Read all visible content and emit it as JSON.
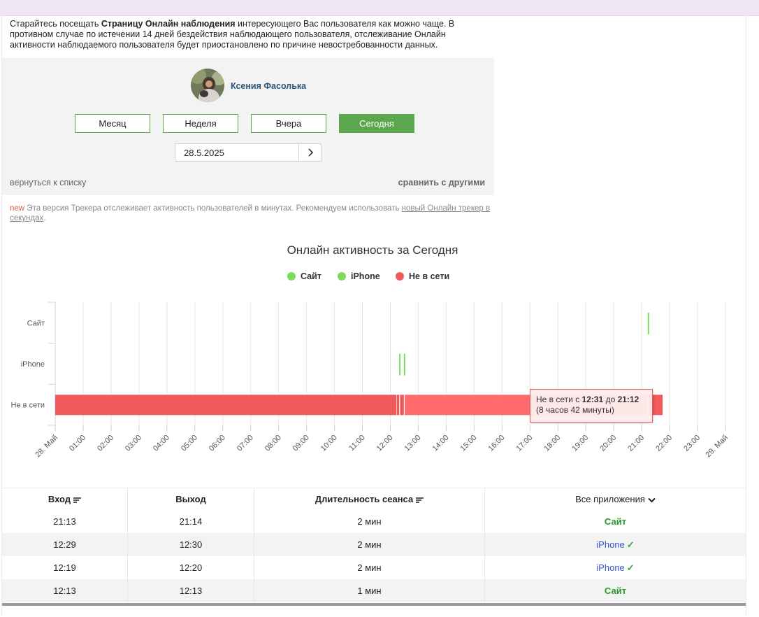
{
  "notice": {
    "pre": "Старайтесь посещать ",
    "bold": "Страницу Онлайн наблюдения",
    "post": " интересующего Вас пользователя как можно чаще. В противном случае по истечении 14 дней бездействия наблюдающего пользователя, отслеживание Онлайн активности наблюдаемого пользователя будет приостановлено по причине невостребованности данных."
  },
  "profile": {
    "name": "Ксения Фасолька"
  },
  "period_buttons": [
    {
      "label": "Месяц",
      "active": false
    },
    {
      "label": "Неделя",
      "active": false
    },
    {
      "label": "Вчера",
      "active": false
    },
    {
      "label": "Сегодня",
      "active": true
    }
  ],
  "date": {
    "value": "28.5.2025",
    "next_icon": "chevron-right-icon"
  },
  "links": {
    "back": "вернуться к списку",
    "compare": "сравнить с другими"
  },
  "new_note": {
    "badge": "new",
    "text": " Эта версия Трекера отслеживает активность пользователей в минутах. Рекомендуем использовать ",
    "link": "новый Онлайн трекер в секундах",
    "end": "."
  },
  "chart_data": {
    "type": "timeline",
    "title": "Онлайн активность за Сегодня",
    "legend": [
      {
        "name": "Сайт",
        "color": "#7ddc5a"
      },
      {
        "name": "iPhone",
        "color": "#7ddc5a"
      },
      {
        "name": "Не в сети",
        "color": "#f05a5a"
      }
    ],
    "categories": [
      "Сайт",
      "iPhone",
      "Не в сети"
    ],
    "x_ticks": [
      "28. Май",
      "01:00",
      "02:00",
      "03:00",
      "04:00",
      "05:00",
      "06:00",
      "07:00",
      "08:00",
      "09:00",
      "10:00",
      "11:00",
      "12:00",
      "13:00",
      "14:00",
      "15:00",
      "16:00",
      "17:00",
      "18:00",
      "19:00",
      "20:00",
      "21:00",
      "22:00",
      "23:00",
      "29. Май"
    ],
    "xlim": [
      "00:00",
      "24:00"
    ],
    "intervals": [
      {
        "category": "Сайт",
        "start": "21:13",
        "end": "21:14"
      },
      {
        "category": "iPhone",
        "start": "12:19",
        "end": "12:20"
      },
      {
        "category": "iPhone",
        "start": "12:29",
        "end": "12:30"
      },
      {
        "category": "Не в сети",
        "start": "00:00",
        "end": "12:13"
      },
      {
        "category": "Не в сети",
        "start": "12:14",
        "end": "12:19"
      },
      {
        "category": "Не в сети",
        "start": "12:21",
        "end": "12:29"
      },
      {
        "category": "Не в сети",
        "start": "12:31",
        "end": "21:12"
      },
      {
        "category": "Не в сети",
        "start": "21:15",
        "end": "21:45"
      }
    ],
    "tooltip": {
      "prefix": "Не в сети с ",
      "from": "12:31",
      "mid": " до ",
      "to": "21:12",
      "duration": "(8 часов 42 минуты)"
    }
  },
  "table": {
    "headers": [
      "Вход",
      "Выход",
      "Длительность сеанса",
      "Все приложения"
    ],
    "rows": [
      {
        "in": "21:13",
        "out": "21:14",
        "duration": "2 мин",
        "app": "Сайт",
        "app_type": "site"
      },
      {
        "in": "12:29",
        "out": "12:30",
        "duration": "2 мин",
        "app": "iPhone",
        "app_type": "iphone"
      },
      {
        "in": "12:19",
        "out": "12:20",
        "duration": "2 мин",
        "app": "iPhone",
        "app_type": "iphone"
      },
      {
        "in": "12:13",
        "out": "12:13",
        "duration": "1 мин",
        "app": "Сайт",
        "app_type": "site"
      }
    ],
    "check": "✓"
  }
}
